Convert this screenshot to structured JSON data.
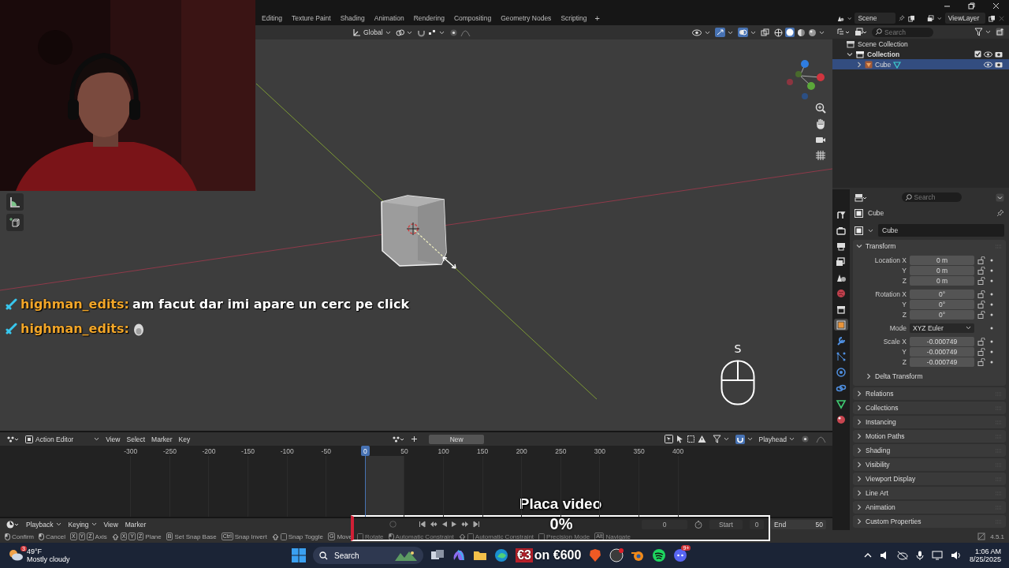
{
  "workspace_tabs": [
    {
      "label": "Editing",
      "selected": false
    },
    {
      "label": "Texture Paint",
      "selected": false
    },
    {
      "label": "Shading",
      "selected": false
    },
    {
      "label": "Animation",
      "selected": false
    },
    {
      "label": "Rendering",
      "selected": false
    },
    {
      "label": "Compositing",
      "selected": false
    },
    {
      "label": "Geometry Nodes",
      "selected": false
    },
    {
      "label": "Scripting",
      "selected": false
    }
  ],
  "add_workspace": "+",
  "viewport_header": {
    "orientation": "Global"
  },
  "chat": [
    {
      "kind": "text",
      "user": "highman_edits:",
      "text": "am facut dar imi apare un cerc pe click"
    },
    {
      "kind": "emote",
      "user": "highman_edits:"
    }
  ],
  "key_overlay": {
    "key": "S"
  },
  "scene_bar": {
    "scene": "Scene",
    "view_layer": "ViewLayer"
  },
  "outliner": {
    "search_placeholder": "Search",
    "tree": [
      {
        "label": "Scene Collection",
        "selected": false,
        "children": [
          {
            "label": "Collection",
            "expanded": true,
            "checked": true,
            "selected": false,
            "children": [
              {
                "label": "Cube",
                "expanded": false,
                "selected": true
              }
            ]
          }
        ]
      }
    ]
  },
  "properties": {
    "search_placeholder": "Search",
    "object_name": "Cube",
    "data_name": "Cube",
    "tabs": [
      {
        "kind": "tool",
        "selected": false
      },
      {
        "kind": "render",
        "selected": false
      },
      {
        "kind": "output",
        "selected": false
      },
      {
        "kind": "view_layer",
        "selected": false
      },
      {
        "kind": "scene",
        "selected": false
      },
      {
        "kind": "world",
        "selected": false
      },
      {
        "kind": "collection",
        "selected": false
      },
      {
        "kind": "object",
        "selected": true
      },
      {
        "kind": "modifiers",
        "selected": false
      },
      {
        "kind": "particles",
        "selected": false
      },
      {
        "kind": "physics",
        "selected": false
      },
      {
        "kind": "constraints",
        "selected": false
      },
      {
        "kind": "data",
        "selected": false
      },
      {
        "kind": "material",
        "selected": false
      }
    ],
    "transform": {
      "title": "Transform",
      "expanded": true,
      "groups": [
        {
          "rows": [
            {
              "kind": "number",
              "label": "Location X",
              "value": "0 m"
            },
            {
              "kind": "number",
              "label": "Y",
              "value": "0 m"
            },
            {
              "kind": "number",
              "label": "Z",
              "value": "0 m"
            }
          ]
        },
        {
          "rows": [
            {
              "kind": "number",
              "label": "Rotation X",
              "value": "0°"
            },
            {
              "kind": "number",
              "label": "Y",
              "value": "0°"
            },
            {
              "kind": "number",
              "label": "Z",
              "value": "0°"
            }
          ]
        },
        {
          "rows": [
            {
              "kind": "dropdown",
              "label": "Mode",
              "value": "XYZ Euler"
            }
          ]
        },
        {
          "rows": [
            {
              "kind": "number",
              "label": "Scale X",
              "value": "-0.000749"
            },
            {
              "kind": "number",
              "label": "Y",
              "value": "-0.000749"
            },
            {
              "kind": "number",
              "label": "Z",
              "value": "-0.000749"
            }
          ]
        }
      ],
      "subpanels": [
        {
          "label": "Delta Transform",
          "expanded": false
        }
      ]
    },
    "panels": [
      {
        "label": "Relations",
        "expanded": false
      },
      {
        "label": "Collections",
        "expanded": false
      },
      {
        "label": "Instancing",
        "expanded": false
      },
      {
        "label": "Motion Paths",
        "expanded": false
      },
      {
        "label": "Shading",
        "expanded": false
      },
      {
        "label": "Visibility",
        "expanded": false
      },
      {
        "label": "Viewport Display",
        "expanded": false
      },
      {
        "label": "Line Art",
        "expanded": false
      },
      {
        "label": "Animation",
        "expanded": false
      },
      {
        "label": "Custom Properties",
        "expanded": false
      }
    ]
  },
  "timeline": {
    "editor": "Action Editor",
    "menus": [
      "View",
      "Select",
      "Marker",
      "Key"
    ],
    "new_button": "New",
    "playhead_menu": "Playhead",
    "ruler": [
      {
        "label": "-300",
        "selected": false
      },
      {
        "label": "-250",
        "selected": false
      },
      {
        "label": "-200",
        "selected": false
      },
      {
        "label": "-150",
        "selected": false
      },
      {
        "label": "-100",
        "selected": false
      },
      {
        "label": "-50",
        "selected": false
      },
      {
        "label": "0",
        "selected": true
      },
      {
        "label": "50",
        "selected": false
      },
      {
        "label": "100",
        "selected": false
      },
      {
        "label": "150",
        "selected": false
      },
      {
        "label": "200",
        "selected": false
      },
      {
        "label": "250",
        "selected": false
      },
      {
        "label": "300",
        "selected": false
      },
      {
        "label": "350",
        "selected": false
      },
      {
        "label": "400",
        "selected": false
      }
    ]
  },
  "playback": {
    "menus": [
      "Playback",
      "Keying",
      "View",
      "Marker"
    ],
    "current_frame": "0",
    "start_label": "Start",
    "start": "0",
    "end_label": "End",
    "end": "50"
  },
  "video_overlay": {
    "title": "Placa video",
    "percent": "0%"
  },
  "status_bar": {
    "items": [
      {
        "kind": "mouse",
        "label": "Confirm"
      },
      {
        "kind": "mouse",
        "label": "Cancel"
      },
      {
        "kind": "keys",
        "keys": [
          "X",
          "Y",
          "Z"
        ],
        "label": "Axis"
      },
      {
        "kind": "shift",
        "keys": [
          "X",
          "Y",
          "Z"
        ],
        "label": "Plane"
      },
      {
        "kind": "keys",
        "keys": [
          "B"
        ],
        "label": "Set Snap Base"
      },
      {
        "kind": "keys",
        "keys": [
          "Ctrl"
        ],
        "label": "Snap Invert"
      },
      {
        "kind": "shift",
        "label": "Snap Toggle"
      },
      {
        "kind": "keys",
        "keys": [
          "G"
        ],
        "label": "Move"
      },
      {
        "kind": "blank",
        "label": "Rotate"
      },
      {
        "kind": "mouse",
        "label": "Automatic Constraint"
      },
      {
        "kind": "shift",
        "label": "Automatic Constraint"
      },
      {
        "kind": "blank",
        "label": "Precision Mode"
      },
      {
        "kind": "keys",
        "keys": [
          "Alt"
        ],
        "label": "Navigate"
      }
    ],
    "version": "4.5.1"
  },
  "taskbar": {
    "weather": {
      "badge": "3",
      "temperature": "49°F",
      "condition": "Mostly cloudy"
    },
    "search": "Search",
    "donation": {
      "amount": "€3",
      "goal": "on €600"
    },
    "discord_badge": "9+",
    "time": "1:06 AM",
    "date": "8/25/2025"
  }
}
